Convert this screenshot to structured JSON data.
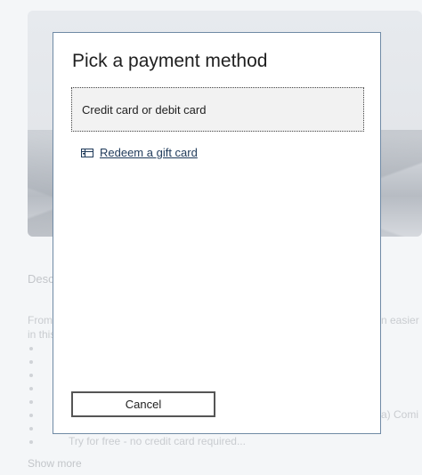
{
  "background": {
    "description_heading": "Desc",
    "lines": [
      "From",
      "in this",
      "n easier t",
      "a) Comi",
      "Try for free - no credit card required..."
    ],
    "show_more": "Show more"
  },
  "dialog": {
    "title": "Pick a payment method",
    "option_credit_card": "Credit card or debit card",
    "redeem_gift_card": "Redeem a gift card",
    "cancel_label": "Cancel"
  },
  "icons": {
    "gift_card": "gift-card-icon"
  },
  "colors": {
    "dialog_border": "#6f8aa5",
    "option_background": "#f2f2f2",
    "link_color": "#1f3a5a"
  }
}
